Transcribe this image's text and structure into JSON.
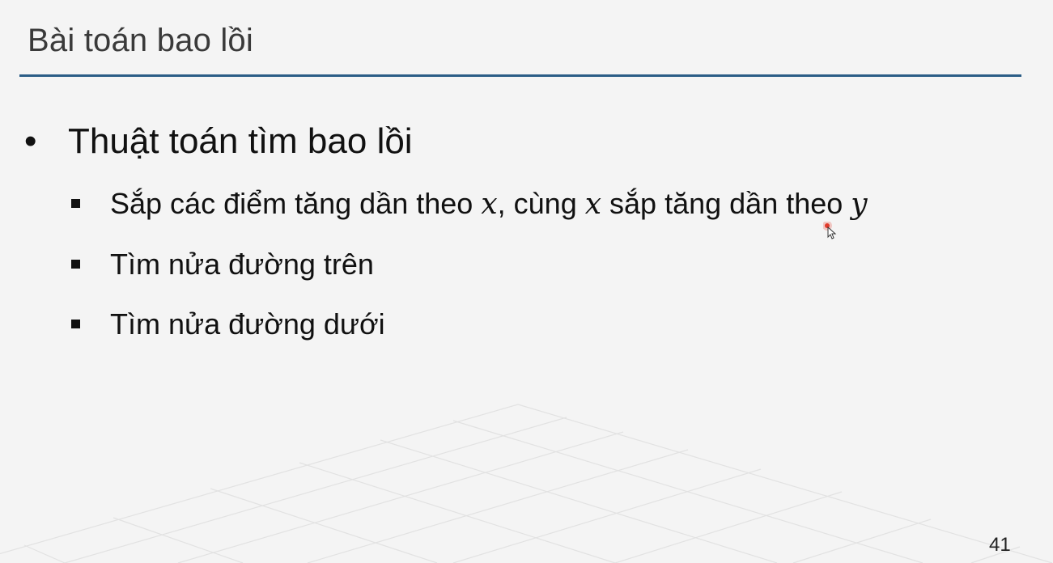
{
  "slide": {
    "title": "Bài toán bao lồi",
    "bullet": "Thuật toán tìm bao lồi",
    "items": [
      {
        "parts": [
          "Sắp các điểm tăng dần theo ",
          "𝑥",
          ", cùng ",
          "𝑥",
          " sắp tăng dần theo ",
          "𝑦"
        ]
      },
      {
        "text": "Tìm nửa đường trên"
      },
      {
        "text": "Tìm nửa đường dưới"
      }
    ],
    "page_number": "41"
  },
  "colors": {
    "background": "#f4f4f4",
    "title_rule": "#2b5d86",
    "laser_pointer": "#e23a2a"
  },
  "icons": {
    "bullet_main": "round-bullet",
    "bullet_sub": "square-bullet",
    "pointer": "laser-pointer-cursor"
  }
}
